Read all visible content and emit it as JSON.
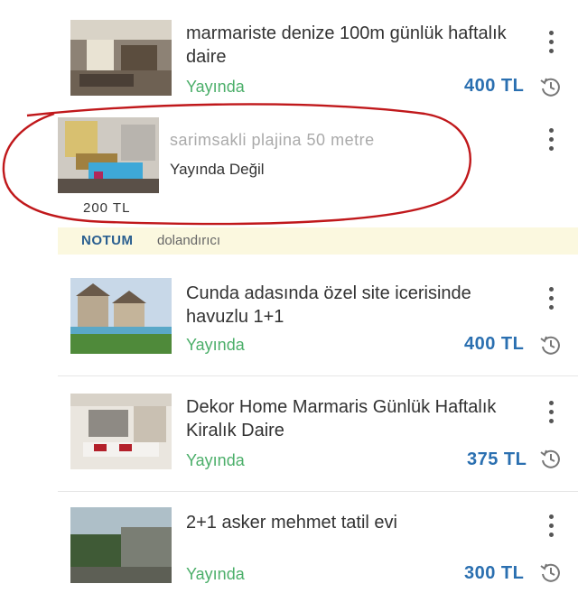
{
  "listings": [
    {
      "title": "marmariste denize 100m günlük haftalık daire",
      "status": "Yayında",
      "price": "400 TL"
    },
    {
      "title": "sarimsakli plajina 50 metre",
      "status": "Yayında Değil",
      "price": "200 TL"
    },
    {
      "title": "Cunda adasında özel site icerisinde havuzlu 1+1",
      "status": "Yayında",
      "price": "400 TL"
    },
    {
      "title": "Dekor Home Marmaris Günlük Haftalık Kiralık Daire",
      "status": "Yayında",
      "price": "375 TL"
    },
    {
      "title": "2+1 asker mehmet tatil evi",
      "status": "Yayında",
      "price": "300 TL"
    }
  ],
  "note": {
    "label": "NOTUM",
    "text": "dolandırıcı"
  },
  "colors": {
    "status_on": "#4caf6a",
    "price": "#2a6fb0",
    "note_bg": "#fbf8df",
    "annotation": "#c0181b"
  }
}
